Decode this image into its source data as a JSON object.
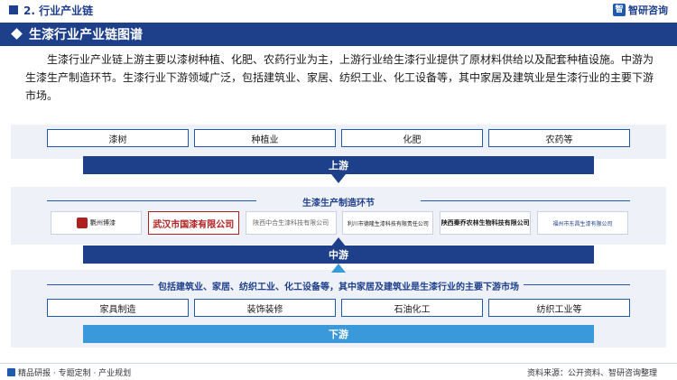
{
  "header": {
    "section": "2. 行业产业链",
    "logo_mark": "智",
    "logo_text": "智研咨询"
  },
  "title": "生漆行业产业链图谱",
  "intro": "生漆行业产业链上游主要以漆树种植、化肥、农药行业为主，上游行业给生漆行业提供了原材料供给以及配套种植设施。中游为生漆生产制造环节。生漆行业下游领域广泛，包括建筑业、家居、纺织工业、化工设备等，其中家居及建筑业是生漆行业的主要下游市场。",
  "upstream": {
    "items": [
      "漆树",
      "种植业",
      "化肥",
      "农药等"
    ],
    "band": "上游"
  },
  "midstream": {
    "caption": "生漆生产制造环节",
    "companies": [
      "氍州博漆",
      "武汉市国漆有限公司",
      "陕西中合生漆科技有限公司",
      "利川市德隆生漆科技有限责任公司",
      "陕西秦乔农林生物科技有限公司",
      "福州市东昌生漆有限公司"
    ],
    "band": "中游"
  },
  "downstream": {
    "caption": "包括建筑业、家居、纺织工业、化工设备等，其中家居及建筑业是生漆行业的主要下游市场",
    "items": [
      "家具制造",
      "装饰装修",
      "石油化工",
      "纺织工业等"
    ],
    "band": "下游"
  },
  "footer": {
    "left": "精品研报 · 专题定制 · 产业规划",
    "right": "资料来源：公开资料、智研咨询整理"
  },
  "colors": {
    "primary": "#1e3f8a",
    "accent": "#1e5bb0",
    "light_band": "#3a9ad9",
    "panel": "#eef2f8"
  }
}
